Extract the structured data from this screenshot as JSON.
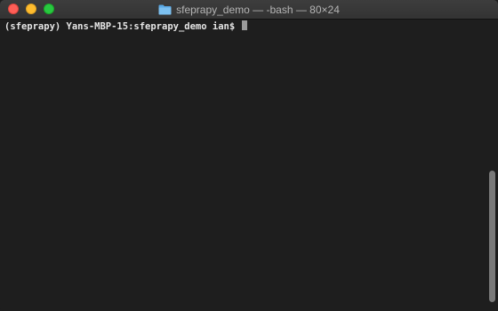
{
  "window": {
    "title": "sfeprapy_demo — -bash — 80×24"
  },
  "terminal": {
    "prompt": "(sfeprapy) Yans-MBP-15:sfeprapy_demo ian$ "
  },
  "icons": {
    "title_icon": "folder-icon"
  },
  "colors": {
    "background": "#1e1e1e",
    "text": "#e6e6e6",
    "close": "#fe5f57",
    "minimize": "#febc2e",
    "zoom": "#28c840",
    "folder": "#6fb3e6"
  }
}
